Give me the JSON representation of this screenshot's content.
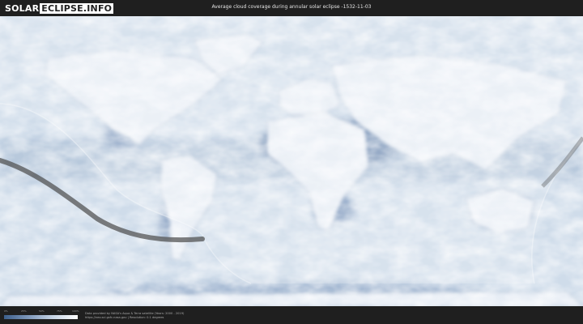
{
  "header": {
    "logo_left": "SOLAR",
    "logo_right": "ECLIPSE.INFO",
    "title": "Average cloud coverage during annular solar eclipse -1532-11-03"
  },
  "legend": {
    "ticks": [
      "0%",
      "25%",
      "50%",
      "75%",
      "100%"
    ],
    "colors": [
      "#3d5f8c",
      "#7e98ba",
      "#c7d5e5",
      "#ffffff"
    ]
  },
  "footer": {
    "credit_line1": "Data provided by NASA's Aqua & Terra satellite (Years: 2000 - 2019)",
    "credit_line2": "https://neo.sci.gsfc.nasa.gov  |  Resolution: 0.1 degrees"
  },
  "colors": {
    "background": "#1f1f1f",
    "cloud_dense": "#f4f7fb",
    "clear_sky": "#4f6f9c",
    "eclipse_path": "#5a5a5a"
  }
}
